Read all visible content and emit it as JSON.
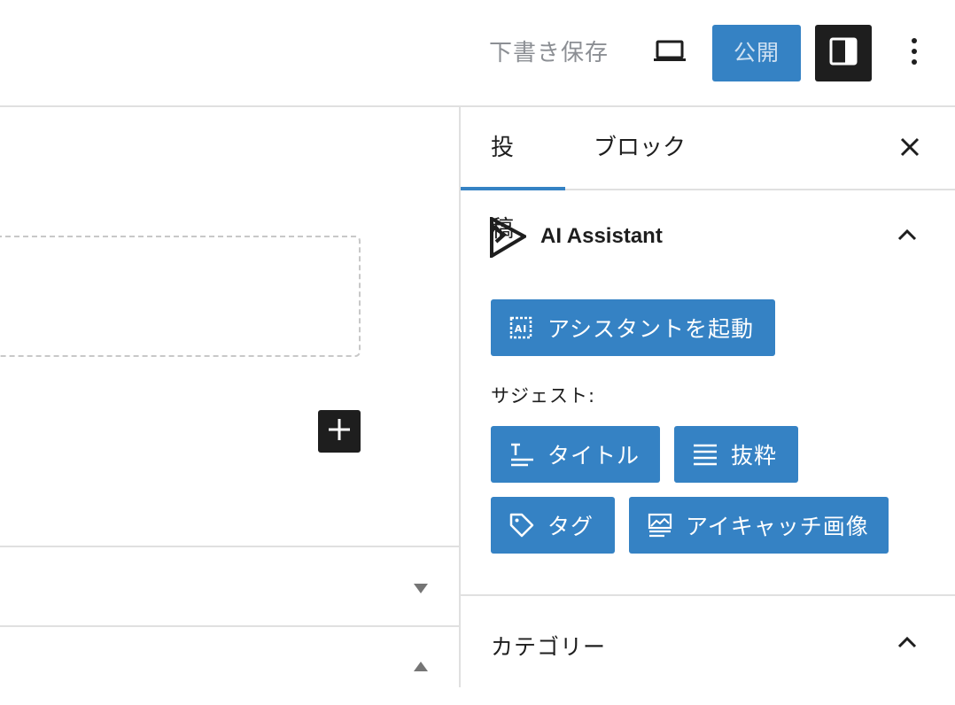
{
  "header": {
    "save_draft_label": "下書き保存",
    "publish_label": "公開",
    "icons": {
      "preview": "laptop-icon",
      "settings": "sidebar-toggle-icon",
      "more": "more-vertical-icon"
    }
  },
  "editor": {
    "icons": {
      "inserter": "plus-icon",
      "panel_collapsed": "caret-down-icon",
      "panel_expanded": "caret-up-icon"
    }
  },
  "sidebar": {
    "tabs": [
      {
        "label": "投稿",
        "active": true
      },
      {
        "label": "ブロック",
        "active": false
      }
    ],
    "ai_panel": {
      "title": "AI Assistant",
      "launch_label": "アシスタントを起動",
      "suggest_label": "サジェスト:",
      "suggestions": [
        {
          "label": "タイトル",
          "icon": "title-icon"
        },
        {
          "label": "抜粋",
          "icon": "excerpt-lines-icon"
        },
        {
          "label": "タグ",
          "icon": "tag-icon"
        },
        {
          "label": "アイキャッチ画像",
          "icon": "featured-image-icon"
        }
      ]
    },
    "category_panel": {
      "title": "カテゴリー"
    }
  },
  "colors": {
    "accent": "#3582c4",
    "dark": "#1e1e1e",
    "border": "#e0e0e0",
    "muted": "#8c8f94"
  }
}
